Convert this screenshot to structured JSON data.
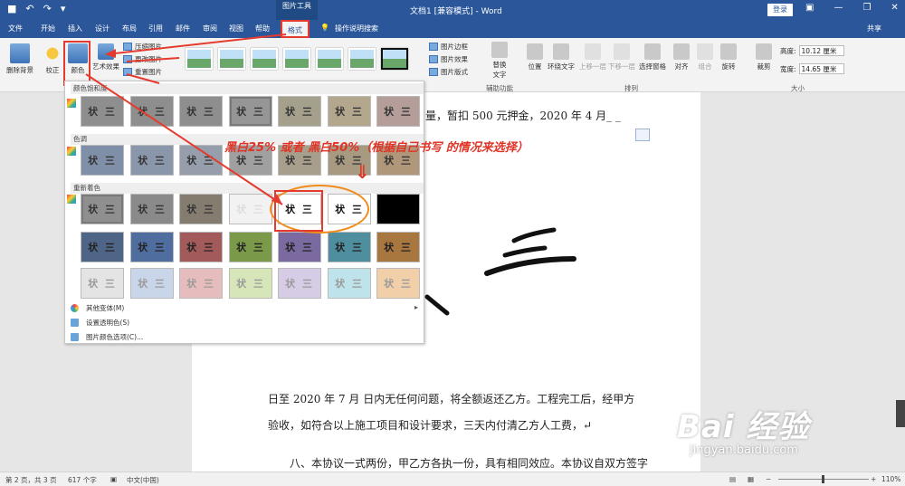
{
  "titlebar": {
    "doc_title": "文档1 [兼容模式] - Word",
    "context_tools": "图片工具",
    "login": "登录",
    "qat": [
      "■",
      "↶",
      "↷",
      "▾"
    ],
    "window_buttons": [
      "▣",
      "—",
      "❐",
      "✕"
    ]
  },
  "tabs": [
    "文件",
    "开始",
    "插入",
    "设计",
    "布局",
    "引用",
    "邮件",
    "审阅",
    "视图",
    "帮助",
    "格式"
  ],
  "tell_me": "操作说明搜索",
  "share": "共享",
  "ribbon": {
    "remove_bg": "删除背景",
    "corrections": "校正",
    "color": "颜色",
    "artistic": "艺术效果",
    "compress": "压缩图片",
    "change": "更改图片",
    "reset": "重置图片",
    "picture_border": "图片边框",
    "picture_effects": "图片效果",
    "picture_layout": "图片版式",
    "alt_text_line1": "替换",
    "alt_text_line2": "文字",
    "alt_group": "辅助功能",
    "position": "位置",
    "wrap": "环绕文字",
    "bring_forward": "上移一层",
    "send_backward": "下移一层",
    "selection_pane": "选择窗格",
    "align": "对齐",
    "group": "组合",
    "rotate": "旋转",
    "arrange_group": "排列",
    "crop": "裁剪",
    "height_label": "高度:",
    "height_value": "10.12 厘米",
    "width_label": "宽度:",
    "width_value": "14.65 厘米",
    "size_group": "大小"
  },
  "dropdown": {
    "saturation_title": "颜色饱和度",
    "tone_title": "色调",
    "recolor_title": "重新着色",
    "swatch_text": "状 三",
    "more_variants": "其他变体(M)",
    "set_transparent": "设置透明色(S)",
    "color_options": "图片颜色选项(C)..."
  },
  "annotation": "黑白25% 或者  黑白50%（根据自己书写 的情况来选择）",
  "doc": {
    "line1": "量，暂扣 500 元押金，2020 年 4 月_ _",
    "line2": "日至  2020 年  7  月  日内无任何问题，将全额返还乙方。工程完工后，经甲方",
    "line3": "验收，如符合以上施工项目和设计要求，三天内付清乙方人工费，↵",
    "line4": "八、本协议一式两份，甲乙方各执一份，具有相同效应。本协议自双方签字"
  },
  "status": {
    "page": "第 2 页，共 3 页",
    "words": "617 个字",
    "lang": "中文(中国)",
    "zoom": "110%"
  },
  "watermark": {
    "main": "Bai 经验",
    "sub": "jingyan.baidu.com"
  },
  "colors": {
    "accent": "#2b579a",
    "highlight": "#e53b2e",
    "ellipse": "#f08c1c"
  }
}
